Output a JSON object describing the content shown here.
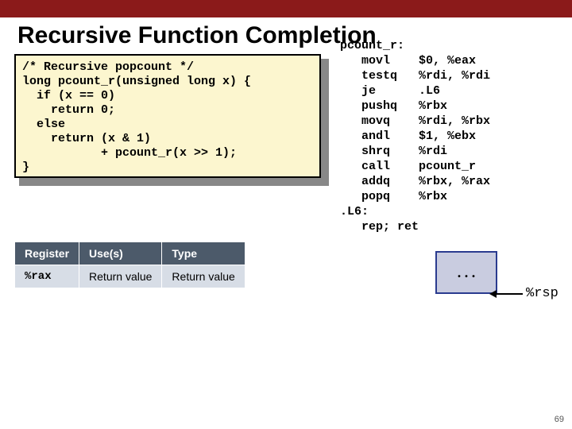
{
  "title": "Recursive Function Completion",
  "code": "/* Recursive popcount */\nlong pcount_r(unsigned long x) {\n  if (x == 0)\n    return 0;\n  else\n    return (x & 1)\n           + pcount_r(x >> 1);\n}",
  "asm": "pcount_r:\n   movl    $0, %eax\n   testq   %rdi, %rdi\n   je      .L6\n   pushq   %rbx\n   movq    %rdi, %rbx\n   andl    $1, %ebx\n   shrq    %rdi\n   call    pcount_r\n   addq    %rbx, %rax\n   popq    %rbx\n.L6:\n   rep; ret",
  "table": {
    "headers": [
      "Register",
      "Use(s)",
      "Type"
    ],
    "rows": [
      {
        "reg": "%rax",
        "use": "Return value",
        "type": "Return value"
      }
    ]
  },
  "stack": {
    "dots": ". . .",
    "rsp": "%rsp"
  },
  "page": "69"
}
